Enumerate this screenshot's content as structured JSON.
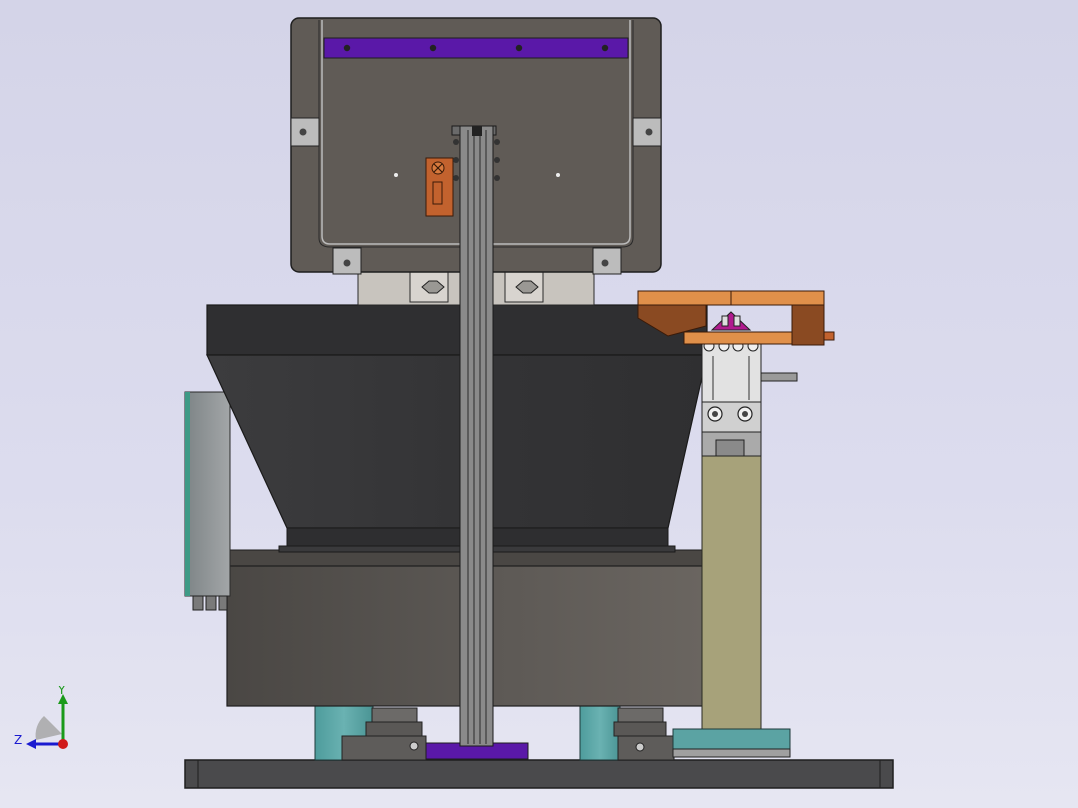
{
  "window": {
    "view_background": "#d8d8ec"
  },
  "model": {
    "colors": {
      "hopper_body": "#605b56",
      "hopper_outline": "#2d2d2d",
      "purple_strip": "#5a18a8",
      "bowl_dark": "#3a3a3c",
      "bowl_base": "#55524f",
      "rail": "#8a8a8a",
      "orange_bracket": "#e0904a",
      "brown_bracket": "#8a4a22",
      "tan_column": "#a7a27a",
      "teal_foot": "#5ba3a3",
      "base_plate": "#4a4a4c",
      "control_box": "#8c8c8c",
      "control_box_edge": "#3e9a86"
    }
  },
  "triad": {
    "y_label": "Y",
    "z_label": "Z",
    "y_color": "#1a9a1a",
    "z_color": "#1a1ad0",
    "x_color": "#d01a1a"
  }
}
